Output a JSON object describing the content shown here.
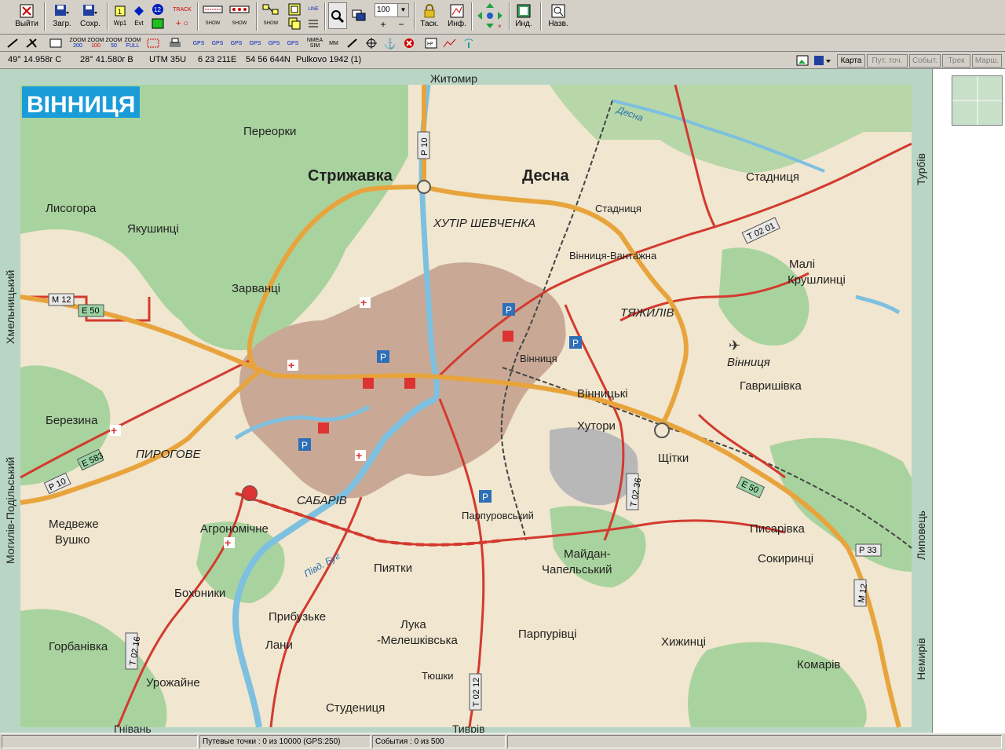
{
  "toolbar": {
    "exit_label": "Выйти",
    "load_label": "Загр.",
    "save_label": "Сохр.",
    "wp_label": "Wp1",
    "evt_label": "Evt",
    "track_label": "TRACK",
    "show_label": "SHOW",
    "zoom_value": "100",
    "task_label": "Таск.",
    "info_label": "Инф.",
    "ind_label": "Инд.",
    "names_label": "Назв.",
    "line_label": "LINE",
    "zoom_buttons": [
      {
        "top": "ZOOM",
        "bottom": "200"
      },
      {
        "top": "ZOOM",
        "bottom": "100"
      },
      {
        "top": "ZOOM",
        "bottom": "50"
      },
      {
        "top": "ZOOM",
        "bottom": "FULL"
      }
    ],
    "gps_label": "GPS",
    "nmea_label": "NMEA",
    "sim_label": "SIM",
    "mm_label": "MM"
  },
  "coords": {
    "lat": "49° 14.958г С",
    "lon": "28° 41.580г В",
    "utm": "UTM  35U",
    "east": "6 23 211E",
    "north": "54 56 644N",
    "datum": "Pulkovo 1942 (1)"
  },
  "tabs": [
    {
      "label": "Карта",
      "enabled": true
    },
    {
      "label": "Пут. точ.",
      "enabled": false
    },
    {
      "label": "Событ.",
      "enabled": false
    },
    {
      "label": "Трек",
      "enabled": false
    },
    {
      "label": "Марш.",
      "enabled": false
    }
  ],
  "status": {
    "waypoints": "Путевые точки : 0 из 10000  (GPS:250)",
    "events": "События : 0 из 500"
  },
  "map": {
    "title": "ВІННИЦЯ",
    "border_top": "Житомир",
    "border_left_top": "Хмельницький",
    "border_left_bottom": "Могилів-Подільський",
    "border_right_top": "Турбів",
    "border_right_mid": "Липовець",
    "border_right_bottom": "Немирів",
    "border_bottom_left": "Гнівань",
    "border_bottom_right": "Тиврів",
    "places": [
      "Переорки",
      "Стрижавка",
      "Десна",
      "Стадниця",
      "Лисогора",
      "Якушинці",
      "ХУТІР ШЕВЧЕНКА",
      "Стадниця",
      "Вінниця-Вантажна",
      "Малі",
      "Крушлинці",
      "Зарванці",
      "ТЯЖИЛІВ",
      "Вінниця",
      "Вінниця",
      "Гавришівка",
      "Березина",
      "Вінницькі",
      "Хутори",
      "ПИРОГОВЕ",
      "Щітки",
      "САБАРІВ",
      "Медвеже",
      "Вушко",
      "Парпуровський",
      "Агрономічне",
      "Писарівка",
      "Майдан-",
      "Чапельський",
      "Сокиринці",
      "Бохоники",
      "Пиятки",
      "Прибузьке",
      "Лука",
      "-Мелешківська",
      "Горбанівка",
      "Лани",
      "Парпурівці",
      "Хижинці",
      "Комарів",
      "Урожайне",
      "Тюшки",
      "Студениця",
      "Півд. Буг",
      "Десна"
    ],
    "road_labels": [
      "М 12",
      "Е 50",
      "Р 10",
      "Е 583",
      "Т 02 01",
      "Т 02 36",
      "Е 50",
      "Р 33",
      "М 12",
      "Т 02 16",
      "Т 02 12",
      "Р 10"
    ]
  }
}
